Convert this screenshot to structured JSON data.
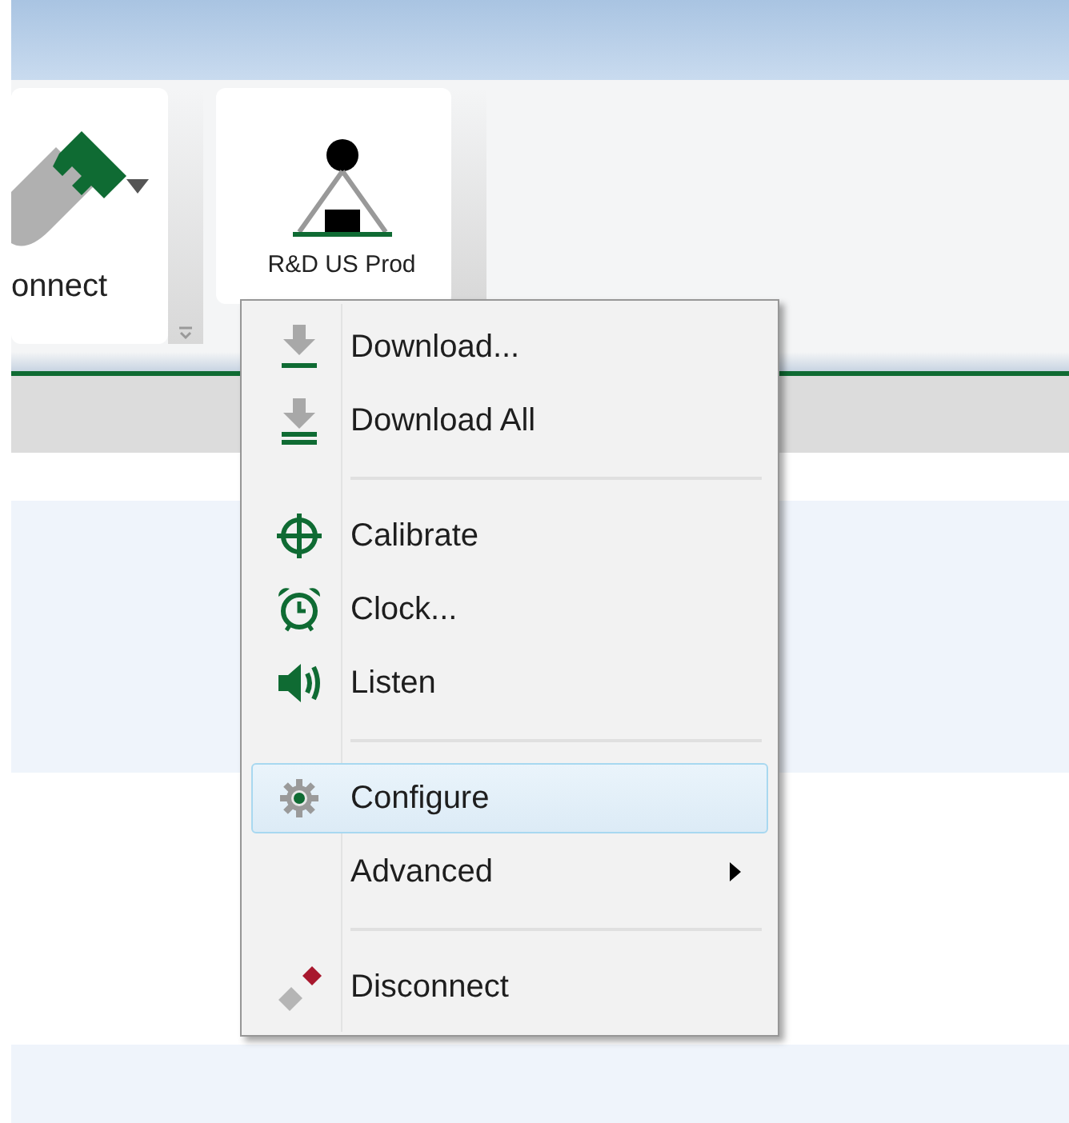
{
  "ribbon": {
    "buttons": [
      {
        "label": "onnect",
        "dropdown": true
      },
      {
        "label": "R&D US Prod",
        "dropdown": false
      }
    ]
  },
  "context_menu": {
    "items": [
      {
        "kind": "item",
        "label": "Download...",
        "selected": false,
        "submenu": false
      },
      {
        "kind": "item",
        "label": "Download All",
        "selected": false,
        "submenu": false
      },
      {
        "kind": "separator"
      },
      {
        "kind": "item",
        "label": "Calibrate",
        "selected": false,
        "submenu": false
      },
      {
        "kind": "item",
        "label": "Clock...",
        "selected": false,
        "submenu": false
      },
      {
        "kind": "item",
        "label": "Listen",
        "selected": false,
        "submenu": false
      },
      {
        "kind": "separator"
      },
      {
        "kind": "item",
        "label": "Configure",
        "selected": true,
        "submenu": false
      },
      {
        "kind": "item",
        "label": "Advanced",
        "selected": false,
        "submenu": true
      },
      {
        "kind": "separator"
      },
      {
        "kind": "item",
        "label": "Disconnect",
        "selected": false,
        "submenu": false
      }
    ]
  }
}
